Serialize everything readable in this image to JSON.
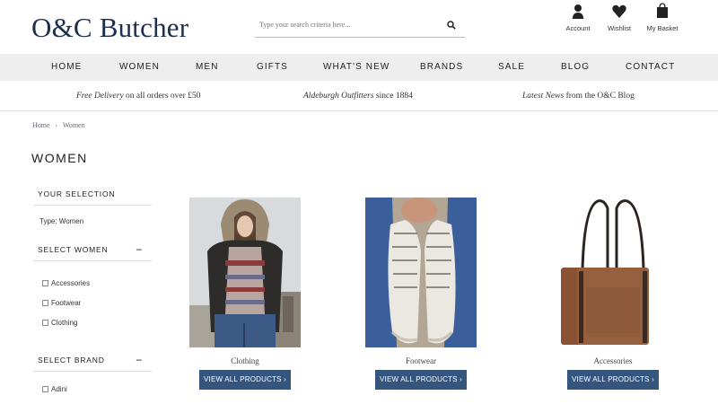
{
  "header": {
    "logo": "O&C Butcher",
    "search_placeholder": "Type your search criteria here...",
    "account_label": "Account",
    "wishlist_label": "Wishlist",
    "basket_label": "My Basket"
  },
  "nav": {
    "items": [
      "HOME",
      "WOMEN",
      "MEN",
      "GIFTS",
      "WHAT'S NEW",
      "BRANDS",
      "SALE",
      "BLOG",
      "CONTACT"
    ]
  },
  "promo": {
    "items": [
      {
        "em": "Free Delivery",
        "rest": " on all orders over £50"
      },
      {
        "em": "Aldeburgh Outfitters",
        "rest": " since 1884"
      },
      {
        "em": "Latest News",
        "rest": " from the O&C Blog"
      }
    ]
  },
  "breadcrumb": {
    "home": "Home",
    "separator": "›",
    "current": "Women"
  },
  "page_title": "WOMEN",
  "sidebar": {
    "your_selection": "YOUR SELECTION",
    "selection_value": "Type: Women",
    "select_women": "SELECT WOMEN",
    "women_options": [
      "Accessories",
      "Footwear",
      "Clothing"
    ],
    "select_brand": "SELECT BRAND",
    "brand_options": [
      "Adini"
    ],
    "toggle_symbol": "−"
  },
  "products": [
    {
      "name": "Clothing",
      "button": "VIEW ALL PRODUCTS ›"
    },
    {
      "name": "Footwear",
      "button": "VIEW ALL PRODUCTS ›"
    },
    {
      "name": "Accessories",
      "button": "VIEW ALL PRODUCTS ›"
    }
  ],
  "colors": {
    "brand": "#1d2f4f",
    "button": "#34557d",
    "nav_bg": "#eeeeee"
  }
}
